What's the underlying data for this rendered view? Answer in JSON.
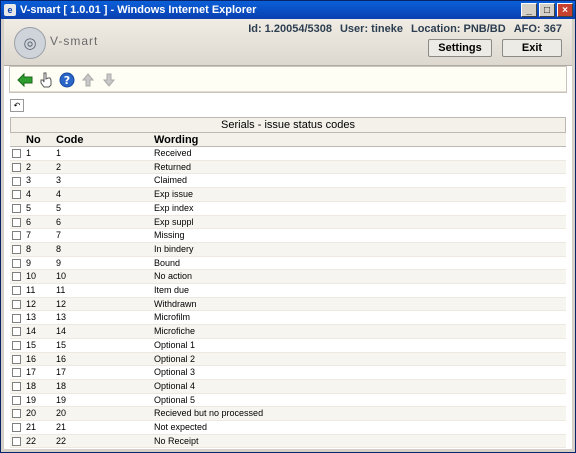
{
  "window": {
    "title": "V-smart [ 1.0.01 ] - Windows Internet Explorer"
  },
  "header": {
    "brand": "V-smart",
    "id": "Id: 1.20054/5308",
    "user": "User: tineke",
    "location": "Location: PNB/BD",
    "afo": "AFO: 367",
    "settings_label": "Settings",
    "exit_label": "Exit"
  },
  "section_title": "Serials - issue status codes",
  "columns": {
    "no": "No",
    "code": "Code",
    "wording": "Wording"
  },
  "rows": [
    {
      "no": "1",
      "code": "1",
      "wording": "Received"
    },
    {
      "no": "2",
      "code": "2",
      "wording": "Returned"
    },
    {
      "no": "3",
      "code": "3",
      "wording": "Claimed"
    },
    {
      "no": "4",
      "code": "4",
      "wording": "Exp issue"
    },
    {
      "no": "5",
      "code": "5",
      "wording": "Exp index"
    },
    {
      "no": "6",
      "code": "6",
      "wording": "Exp suppl"
    },
    {
      "no": "7",
      "code": "7",
      "wording": "Missing"
    },
    {
      "no": "8",
      "code": "8",
      "wording": "In bindery"
    },
    {
      "no": "9",
      "code": "9",
      "wording": "Bound"
    },
    {
      "no": "10",
      "code": "10",
      "wording": "No action"
    },
    {
      "no": "11",
      "code": "11",
      "wording": "Item due"
    },
    {
      "no": "12",
      "code": "12",
      "wording": "Withdrawn"
    },
    {
      "no": "13",
      "code": "13",
      "wording": "Microfilm"
    },
    {
      "no": "14",
      "code": "14",
      "wording": "Microfiche"
    },
    {
      "no": "15",
      "code": "15",
      "wording": "Optional 1"
    },
    {
      "no": "16",
      "code": "16",
      "wording": "Optional 2"
    },
    {
      "no": "17",
      "code": "17",
      "wording": "Optional 3"
    },
    {
      "no": "18",
      "code": "18",
      "wording": "Optional 4"
    },
    {
      "no": "19",
      "code": "19",
      "wording": "Optional 5"
    },
    {
      "no": "20",
      "code": "20",
      "wording": "Recieved but no processed"
    },
    {
      "no": "21",
      "code": "21",
      "wording": "Not expected"
    },
    {
      "no": "22",
      "code": "22",
      "wording": "No Receipt"
    }
  ],
  "icons": {
    "back": "back-arrow-icon",
    "select": "hand-pointer-icon",
    "help": "help-icon",
    "up": "arrow-up-icon",
    "down": "arrow-down-icon",
    "undo": "undo-icon"
  }
}
